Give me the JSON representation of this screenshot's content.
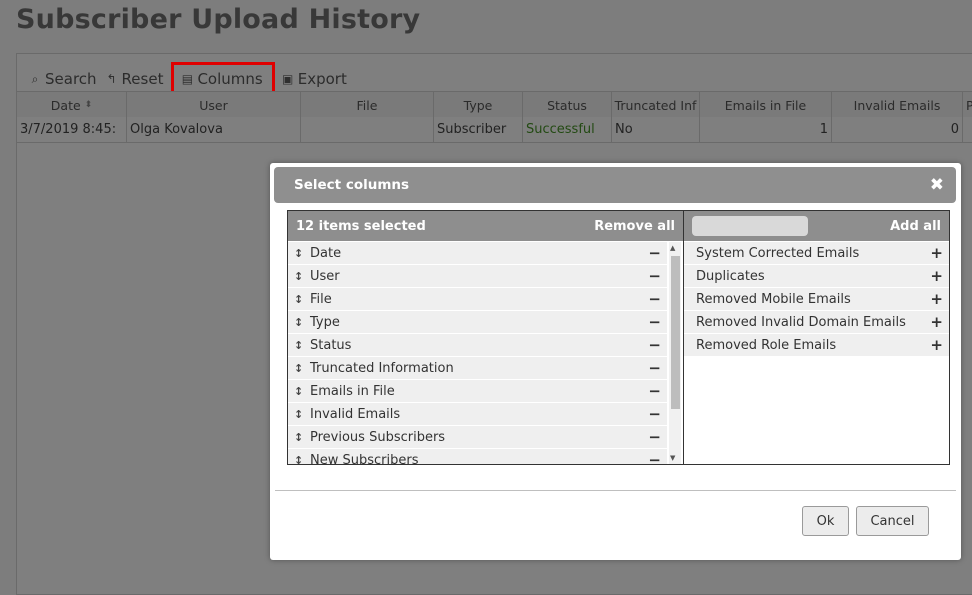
{
  "page": {
    "title": "Subscriber Upload History"
  },
  "toolbar": {
    "search": "Search",
    "reset": "Reset",
    "columns": "Columns",
    "export": "Export"
  },
  "grid": {
    "headers": {
      "date": "Date",
      "user": "User",
      "file": "File",
      "type": "Type",
      "status": "Status",
      "truncated": "Truncated Inf",
      "emails_in_file": "Emails in File",
      "invalid_emails": "Invalid Emails",
      "previous": "P"
    },
    "row": {
      "date": "3/7/2019 8:45:",
      "user": "Olga Kovalova",
      "file": "",
      "type": "Subscriber",
      "status": "Successful",
      "truncated": "No",
      "emails_in_file": "1",
      "invalid_emails": "0"
    }
  },
  "modal": {
    "title": "Select columns",
    "selected_count": "12 items selected",
    "remove_all": "Remove all",
    "add_all": "Add all",
    "selected_items": [
      "Date",
      "User",
      "File",
      "Type",
      "Status",
      "Truncated Information",
      "Emails in File",
      "Invalid Emails",
      "Previous Subscribers",
      "New Subscribers"
    ],
    "available_items": [
      "System Corrected Emails",
      "Duplicates",
      "Removed Mobile Emails",
      "Removed Invalid Domain Emails",
      "Removed Role Emails"
    ],
    "ok": "Ok",
    "cancel": "Cancel"
  }
}
